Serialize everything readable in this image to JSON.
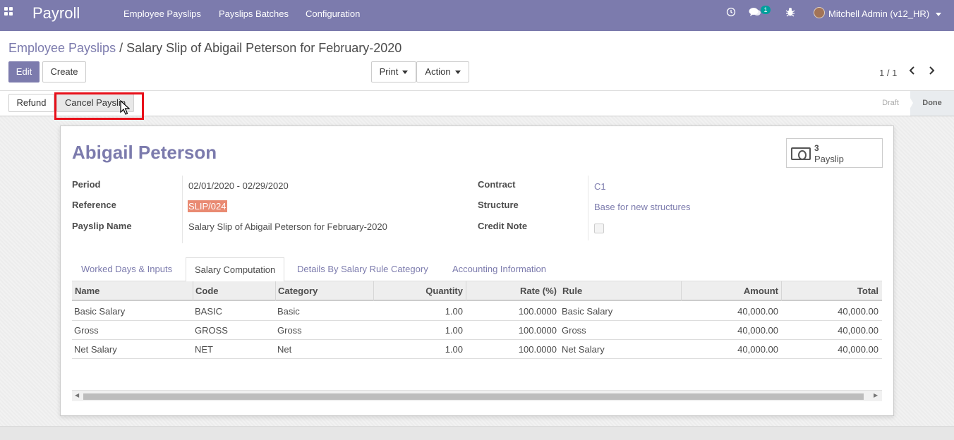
{
  "navbar": {
    "app_name": "Payroll",
    "menus": [
      "Employee Payslips",
      "Payslips Batches",
      "Configuration"
    ],
    "message_count": "1",
    "user": "Mitchell Admin (v12_HR)"
  },
  "breadcrumb": {
    "parent": "Employee Payslips",
    "separator": " / ",
    "current": "Salary Slip of Abigail Peterson for February-2020"
  },
  "buttons": {
    "edit": "Edit",
    "create": "Create",
    "print": "Print",
    "action": "Action",
    "refund": "Refund",
    "cancel_payslip": "Cancel Payslip"
  },
  "pager": {
    "value": "1 / 1"
  },
  "status": {
    "draft": "Draft",
    "done": "Done"
  },
  "form": {
    "employee_name": "Abigail Peterson",
    "smart_button": {
      "count": "3",
      "label": "Payslip"
    },
    "left_fields": [
      {
        "label": "Period",
        "value": "02/01/2020 - 02/29/2020"
      },
      {
        "label": "Reference",
        "value": "SLIP/024"
      },
      {
        "label": "Payslip Name",
        "value": "Salary Slip of Abigail Peterson for February-2020"
      }
    ],
    "right_fields": [
      {
        "label": "Contract",
        "value": "C1"
      },
      {
        "label": "Structure",
        "value": "Base for new structures"
      },
      {
        "label": "Credit Note",
        "value": ""
      }
    ]
  },
  "tabs": [
    "Worked Days & Inputs",
    "Salary Computation",
    "Details By Salary Rule Category",
    "Accounting Information"
  ],
  "table": {
    "columns": [
      "Name",
      "Code",
      "Category",
      "Quantity",
      "Rate (%)",
      "Rule",
      "Amount",
      "Total"
    ],
    "rows": [
      [
        "Basic Salary",
        "BASIC",
        "Basic",
        "1.00",
        "100.0000",
        "Basic Salary",
        "40,000.00",
        "40,000.00"
      ],
      [
        "Gross",
        "GROSS",
        "Gross",
        "1.00",
        "100.0000",
        "Gross",
        "40,000.00",
        "40,000.00"
      ],
      [
        "Net Salary",
        "NET",
        "Net",
        "1.00",
        "100.0000",
        "Net Salary",
        "40,000.00",
        "40,000.00"
      ]
    ]
  },
  "colors": {
    "brand": "#7c7bad",
    "highlight": "#e8101a",
    "reference_bg": "#e98a72"
  }
}
